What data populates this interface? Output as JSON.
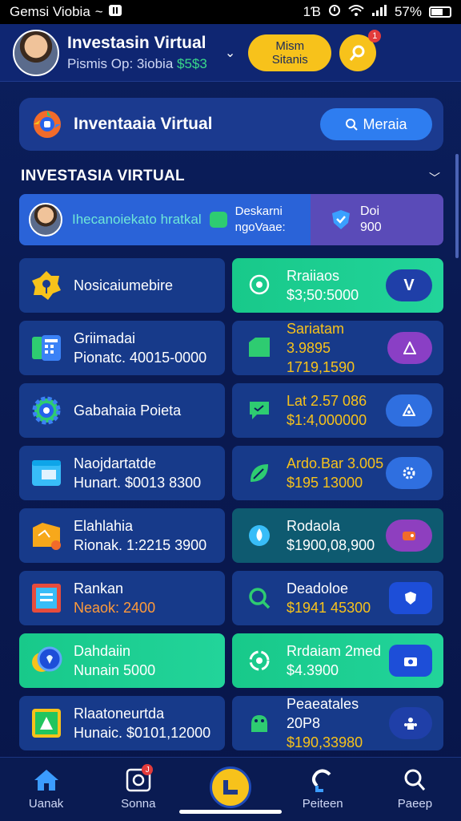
{
  "status_bar": {
    "carrier": "Gemsi Viobia",
    "left_glyphs": "~",
    "signal_text": "1Ɓ",
    "battery": "57%"
  },
  "header": {
    "title": "Investasin Virtual",
    "subtitle_label": "Pismis Op: 3iobia",
    "subtitle_gain": "$5$3",
    "pill_label_1": "Mism",
    "pill_label_2": "Sitanis",
    "notification_count": "1"
  },
  "app_card": {
    "title": "Inventaaia Virtual",
    "button_label": "Meraia"
  },
  "section": {
    "title": "INVESTASIA VIRTUAL"
  },
  "banner": {
    "text": "Ihecanoiekato hratkal",
    "mid_1": "Deskarni",
    "mid_2": "ngoVaae:",
    "right_1": "Doi",
    "right_2": "900"
  },
  "left_cards": [
    {
      "t1": "Nosicaiumebire",
      "t2": ""
    },
    {
      "t1": "Griimadai",
      "t2": "Pionatc. 40015-0000"
    },
    {
      "t1": "Gabahaia Poieta",
      "t2": ""
    },
    {
      "t1": "Naojdartatde",
      "t2": "Hunart. $0013 8300"
    },
    {
      "t1": "Elahlahia",
      "t2": "Rionak. 1:2215 3900"
    },
    {
      "t1": "Rankan",
      "t2": "Neaok: 2400"
    },
    {
      "t1": "Dahdaiin",
      "t2": "Nunain 5000"
    },
    {
      "t1": "Rlaatoneurtda",
      "t2": "Hunaic. $0101,12000"
    }
  ],
  "right_cards": [
    {
      "t1": "Rraiiaos",
      "t2": "$3;50:5000"
    },
    {
      "t1": "Sariatam 3.9895",
      "t2": "1719,1590"
    },
    {
      "t1": "Lat 2.57 086",
      "t2": "$1:4,000000"
    },
    {
      "t1": "Ardo.Bar 3.005",
      "t2": "$195 13000"
    },
    {
      "t1": "Rodaola",
      "t2": "$1900,08,900"
    },
    {
      "t1": "Deadoloe",
      "t2": "$1941 45300"
    },
    {
      "t1": "Rrdaiam 2med",
      "t2": "$4.3900"
    },
    {
      "t1": "Peaeatales 20P8",
      "t2": "$190,33980"
    }
  ],
  "bottom_nav": {
    "item1": "Uanak",
    "item2": "Sonna",
    "item4": "Peiteen",
    "item5": "Paeep",
    "badge": "J"
  },
  "colors": {
    "accent_yellow": "#f7c21b",
    "accent_green": "#18c98a",
    "accent_blue": "#2f6fe0",
    "bg_navy": "#0b1f5e"
  }
}
